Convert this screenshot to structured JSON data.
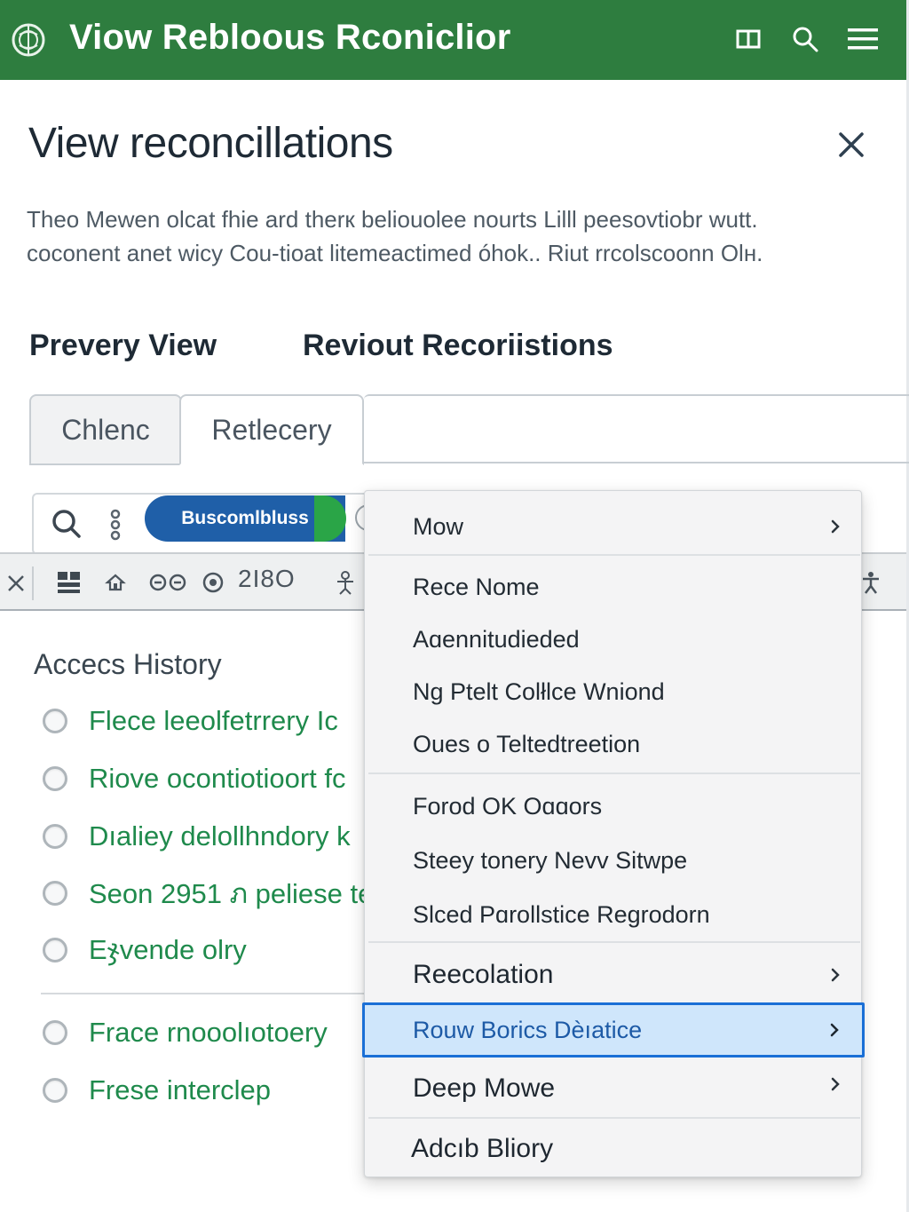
{
  "appbar": {
    "title": "Viow Rebloous Rconiclior",
    "bg_color": "#2e7d3f",
    "icons": [
      "globe-logo-icon",
      "columns-icon",
      "search-icon",
      "menu-icon"
    ]
  },
  "page": {
    "title": "View reconcillations",
    "description_line1": "Theo Mewen olcat fhie ard therк beliouolee nourts Lilll peesovtiobr wutt.",
    "description_line2": "coconent anet wicy Cou-tioat litemeactimed óhok.. Riut rrcolscoonn Olн.",
    "subheading_left": "Prevery View",
    "subheading_right": "Reviout Recoriistions"
  },
  "tabs": [
    {
      "label": "Chlenc",
      "active": false
    },
    {
      "label": "Retlecery",
      "active": true
    }
  ],
  "search": {
    "pill_label": "Buscomlbluss",
    "pill_color": "#1f5fa8",
    "pill_tail_color": "#2aa547"
  },
  "toolbar": {
    "zoom_text": "2I8O",
    "icons": [
      "close-icon",
      "grid-icon",
      "home-icon",
      "binoculars-icon",
      "at-icon",
      "person-icon",
      "accessibility-icon"
    ]
  },
  "history": {
    "title": "Accecs History",
    "items": [
      "Flece leeolfetrrery Ic",
      "Riove ocontiotioort fc",
      "Dıaliey delollhndory k",
      "Seon 2951 ภ peliese te",
      "Eჯvende olry",
      "Frace rnooolıotoery",
      "Frese interclep"
    ],
    "link_color": "#1f8a4c"
  },
  "menu": {
    "items": [
      {
        "label": "Mow",
        "submenu": true
      },
      {
        "label": "Rece Nome",
        "submenu": false
      },
      {
        "label": "Aɑennitudieded",
        "submenu": false
      },
      {
        "label": "Ng Ptelt Colłlce Wniond",
        "submenu": false
      },
      {
        "label": "Oues o Teltedtreetion",
        "submenu": false
      },
      {
        "label": "Forod OK Oɑɑors",
        "submenu": false
      },
      {
        "label": "Steey tonery Nevv Sitwpe",
        "submenu": false
      },
      {
        "label": "Slced Pɑrollstice Regrodorn",
        "submenu": false
      },
      {
        "label": "Reecolation",
        "submenu": true
      },
      {
        "label": "Rouw Borics Dèıatice",
        "submenu": true,
        "selected": true
      },
      {
        "label": "Deep Mowe",
        "submenu": true
      },
      {
        "label": "Adcıb Bliory",
        "submenu": false
      }
    ],
    "selected_border_color": "#1a6fd6",
    "selected_bg_color": "#cfe6fb"
  }
}
